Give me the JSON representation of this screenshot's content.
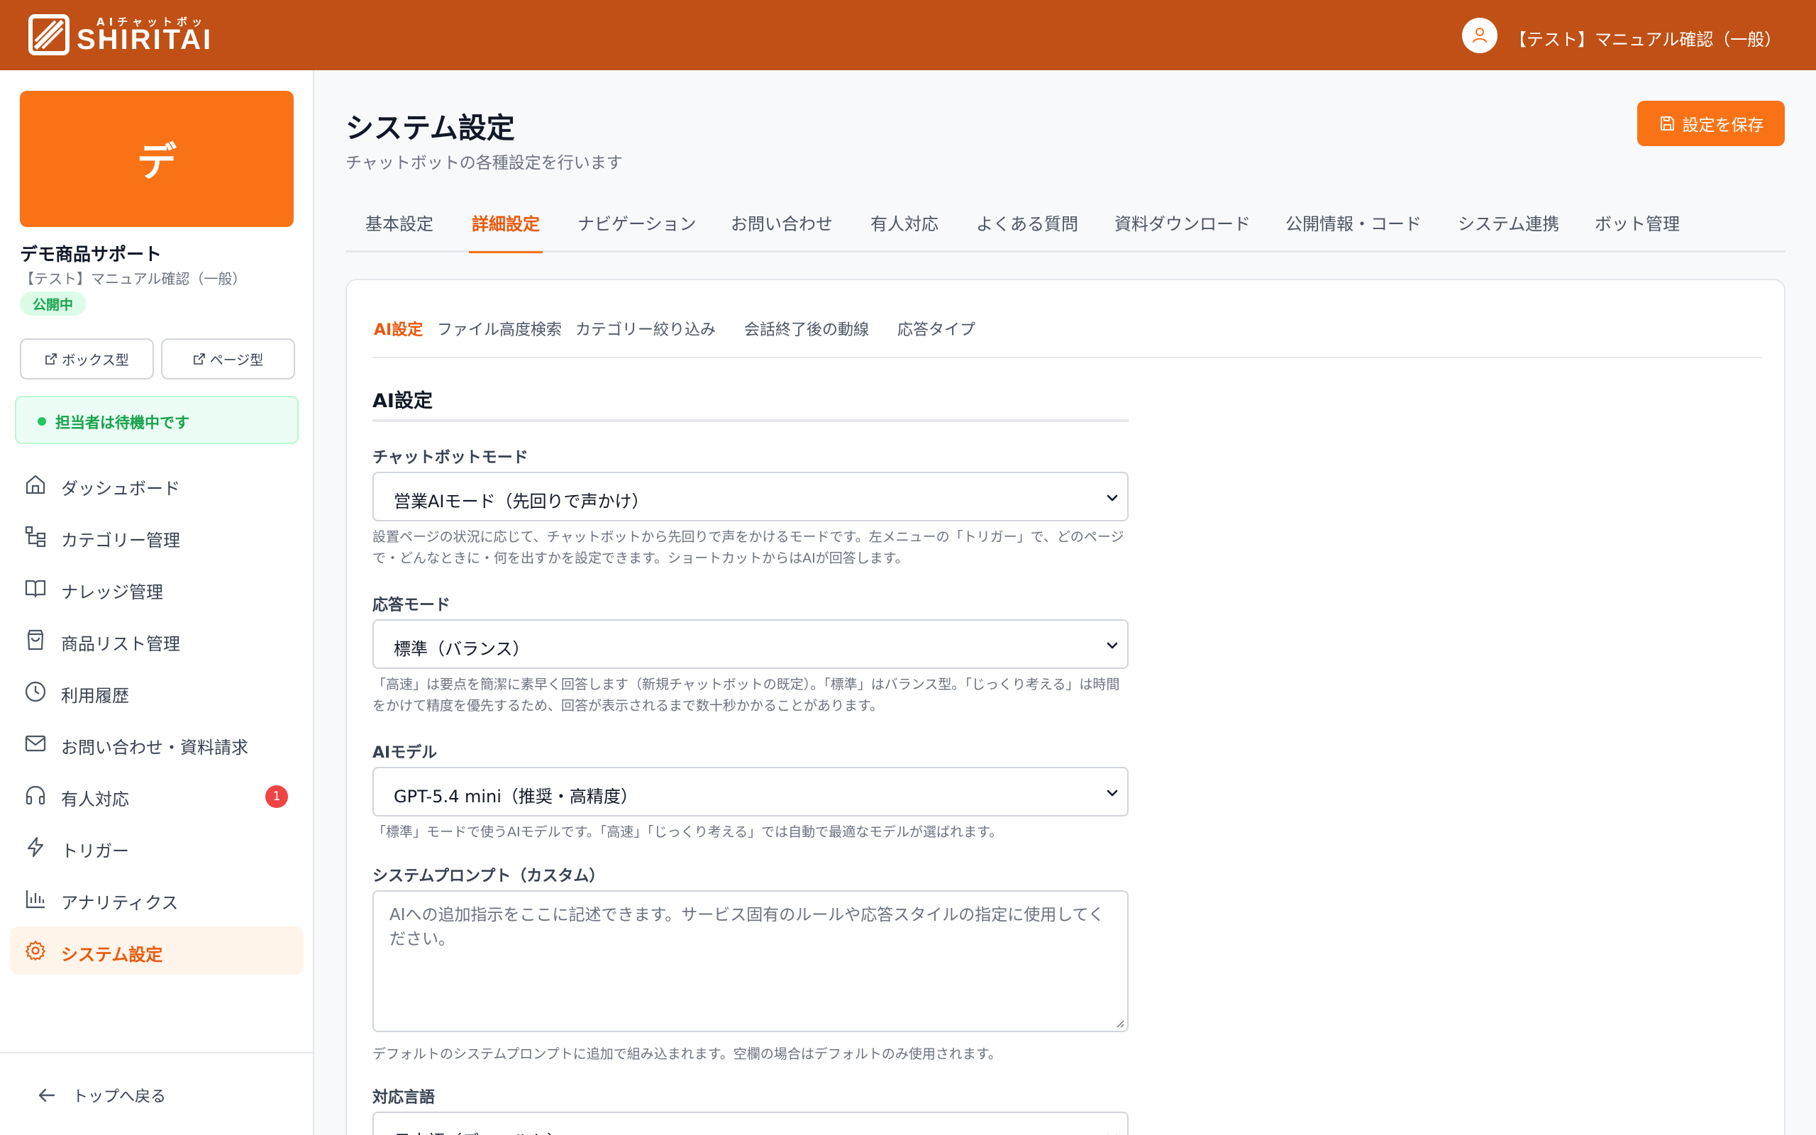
{
  "header": {
    "logo_sub": "AIチャットボット",
    "logo_text": "SHIRITAI",
    "user_name": "【テスト】マニュアル確認（一般）"
  },
  "sidebar": {
    "bot_initial": "デ",
    "bot_name": "デモ商品サポート",
    "bot_sub": "【テスト】マニュアル確認（一般）",
    "status_badge": "公開中",
    "box_type_button": "ボックス型",
    "page_type_button": "ページ型",
    "agent_status": "担当者は待機中です",
    "nav_items": [
      {
        "label": "ダッシュボード",
        "icon": "home-icon"
      },
      {
        "label": "カテゴリー管理",
        "icon": "category-tree-icon"
      },
      {
        "label": "ナレッジ管理",
        "icon": "book-icon"
      },
      {
        "label": "商品リスト管理",
        "icon": "shopping-bag-icon"
      },
      {
        "label": "利用履歴",
        "icon": "clock-icon"
      },
      {
        "label": "お問い合わせ・資料請求",
        "icon": "mail-icon"
      },
      {
        "label": "有人対応",
        "icon": "headset-icon",
        "badge": "1"
      },
      {
        "label": "トリガー",
        "icon": "lightning-icon"
      },
      {
        "label": "アナリティクス",
        "icon": "bar-chart-icon"
      },
      {
        "label": "システム設定",
        "icon": "gear-icon",
        "active": true
      }
    ],
    "back_link": "トップへ戻る"
  },
  "main": {
    "title": "システム設定",
    "subtitle": "チャットボットの各種設定を行います",
    "save_button": "設定を保存",
    "tabs": [
      "基本設定",
      "詳細設定",
      "ナビゲーション",
      "お問い合わせ",
      "有人対応",
      "よくある質問",
      "資料ダウンロード",
      "公開情報・コード",
      "システム連携",
      "ボット管理"
    ],
    "active_tab": "詳細設定",
    "subtabs": [
      "AI設定",
      "ファイル高度検索",
      "カテゴリー絞り込み",
      "会話終了後の動線",
      "応答タイプ"
    ],
    "active_subtab": "AI設定",
    "section_title": "AI設定",
    "fields": {
      "chatbot_mode": {
        "label": "チャットボットモード",
        "value": "営業AIモード（先回りで声かけ）",
        "help": "設置ページの状況に応じて、チャットボットから先回りで声をかけるモードです。左メニューの「トリガー」で、どのページで・どんなときに・何を出すかを設定できます。ショートカットからはAIが回答します。"
      },
      "response_mode": {
        "label": "応答モード",
        "value": "標準（バランス）",
        "help": "「高速」は要点を簡潔に素早く回答します（新規チャットボットの既定）。「標準」はバランス型。「じっくり考える」は時間をかけて精度を優先するため、回答が表示されるまで数十秒かかることがあります。"
      },
      "ai_model": {
        "label": "AIモデル",
        "value": "GPT-5.4 mini（推奨・高精度）",
        "help": "「標準」モードで使うAIモデルです。「高速」「じっくり考える」では自動で最適なモデルが選ばれます。"
      },
      "system_prompt": {
        "label": "システムプロンプト（カスタム）",
        "placeholder": "AIへの追加指示をここに記述できます。サービス固有のルールや応答スタイルの指定に使用してください。",
        "help": "デフォルトのシステムプロンプトに追加で組み込まれます。空欄の場合はデフォルトのみ使用されます。"
      },
      "language": {
        "label": "対応言語",
        "value": "日本語（デフォルト）"
      }
    }
  },
  "colors": {
    "header": "#c05015",
    "accent": "#f97316",
    "accent_text": "#ea580c",
    "success": "#16a34a",
    "badge": "#ef4444"
  }
}
